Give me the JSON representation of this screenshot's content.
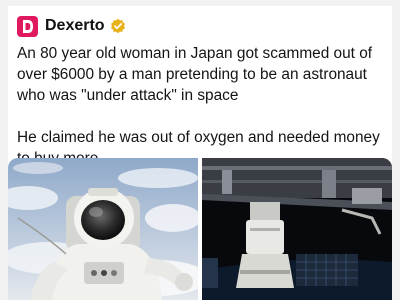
{
  "account": {
    "name": "Dexerto",
    "verified": true,
    "avatar_color": "#e0185f",
    "badge_color": "#e8b21a",
    "avatar_icon": "dexerto-logo-icon",
    "badge_icon": "verified-badge-icon"
  },
  "tweet": {
    "paragraph_1": "An 80 year old woman in Japan got scammed out of over $6000 by a man pretending to be an astronaut who was \"under attack\" in space",
    "paragraph_2": "He claimed he was out of oxygen and needed money to buy more"
  },
  "media": [
    {
      "label": "astronaut-spacewalk-photo"
    },
    {
      "label": "space-station-photo"
    }
  ]
}
